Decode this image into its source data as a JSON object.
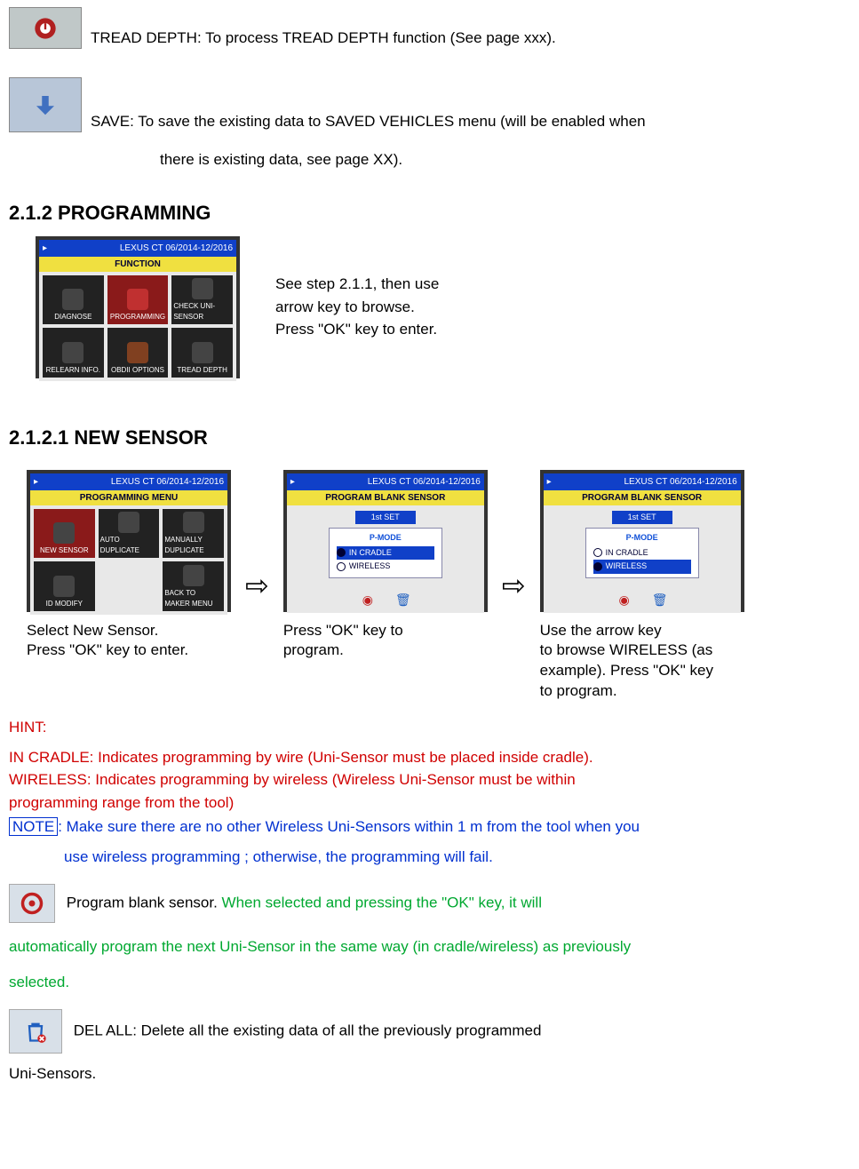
{
  "top": {
    "tread_depth": "TREAD DEPTH: To process TREAD DEPTH function (See page xxx).",
    "save_line1": "SAVE: To save the existing data to SAVED VEHICLES menu (will be enabled when",
    "save_line2": "there is existing data, see page XX)."
  },
  "headings": {
    "programming": "2.1.2 PROGRAMMING",
    "new_sensor": "2.1.2.1 NEW SENSOR"
  },
  "programming_caption": {
    "l1": "See step 2.1.1, then use",
    "l2": "arrow key to browse.",
    "l3": "Press \"OK\" key to enter."
  },
  "device": {
    "title": "LEXUS  CT  06/2014-12/2016",
    "function_label": "FUNCTION",
    "cells": [
      "DIAGNOSE",
      "PROGRAMMING",
      "CHECK UNI-SENSOR",
      "RELEARN INFO.",
      "OBDII OPTIONS",
      "TREAD DEPTH"
    ],
    "prog_menu_label": "PROGRAMMING MENU",
    "prog_cells": [
      "NEW SENSOR",
      "AUTO DUPLICATE",
      "MANUALLY DUPLICATE",
      "ID MODIFY",
      "",
      "BACK TO MAKER MENU"
    ],
    "blank_label": "PROGRAM BLANK SENSOR",
    "set_label": "1st SET",
    "pmode_label": "P-MODE",
    "opt1": "IN CRADLE",
    "opt2": "WIRELESS"
  },
  "captions": {
    "c1a": "Select New Sensor.",
    "c1b": "Press \"OK\" key to enter.",
    "c2a": "Press \"OK\" key to",
    "c2b": "program.",
    "c3a": "Use the arrow key",
    "c3b": "to browse WIRELESS (as",
    "c3c": "example). Press \"OK\" key",
    "c3d": "to program."
  },
  "hint": {
    "label": "HINT:",
    "l1": "IN CRADLE: Indicates programming by wire (Uni-Sensor must be placed inside cradle).",
    "l2": "WIRELESS: Indicates programming by wireless (Wireless Uni-Sensor must be within",
    "l3": "programming range from the tool)"
  },
  "note": {
    "label": "NOTE",
    "text1": ": Make sure there are no other Wireless Uni-Sensors within 1 m from the tool when you",
    "text2": "use wireless programming ; otherwise, the programming will fail."
  },
  "program_blank": {
    "black": "Program blank sensor. ",
    "green1": "When selected and pressing the \"OK\" key, it will",
    "green2": "automatically program the next Uni-Sensor in the same way (in cradle/wireless) as previously",
    "green3": "selected."
  },
  "delall": {
    "l1": "DEL ALL: Delete all the existing data of all the previously programmed",
    "l2": "Uni-Sensors."
  }
}
